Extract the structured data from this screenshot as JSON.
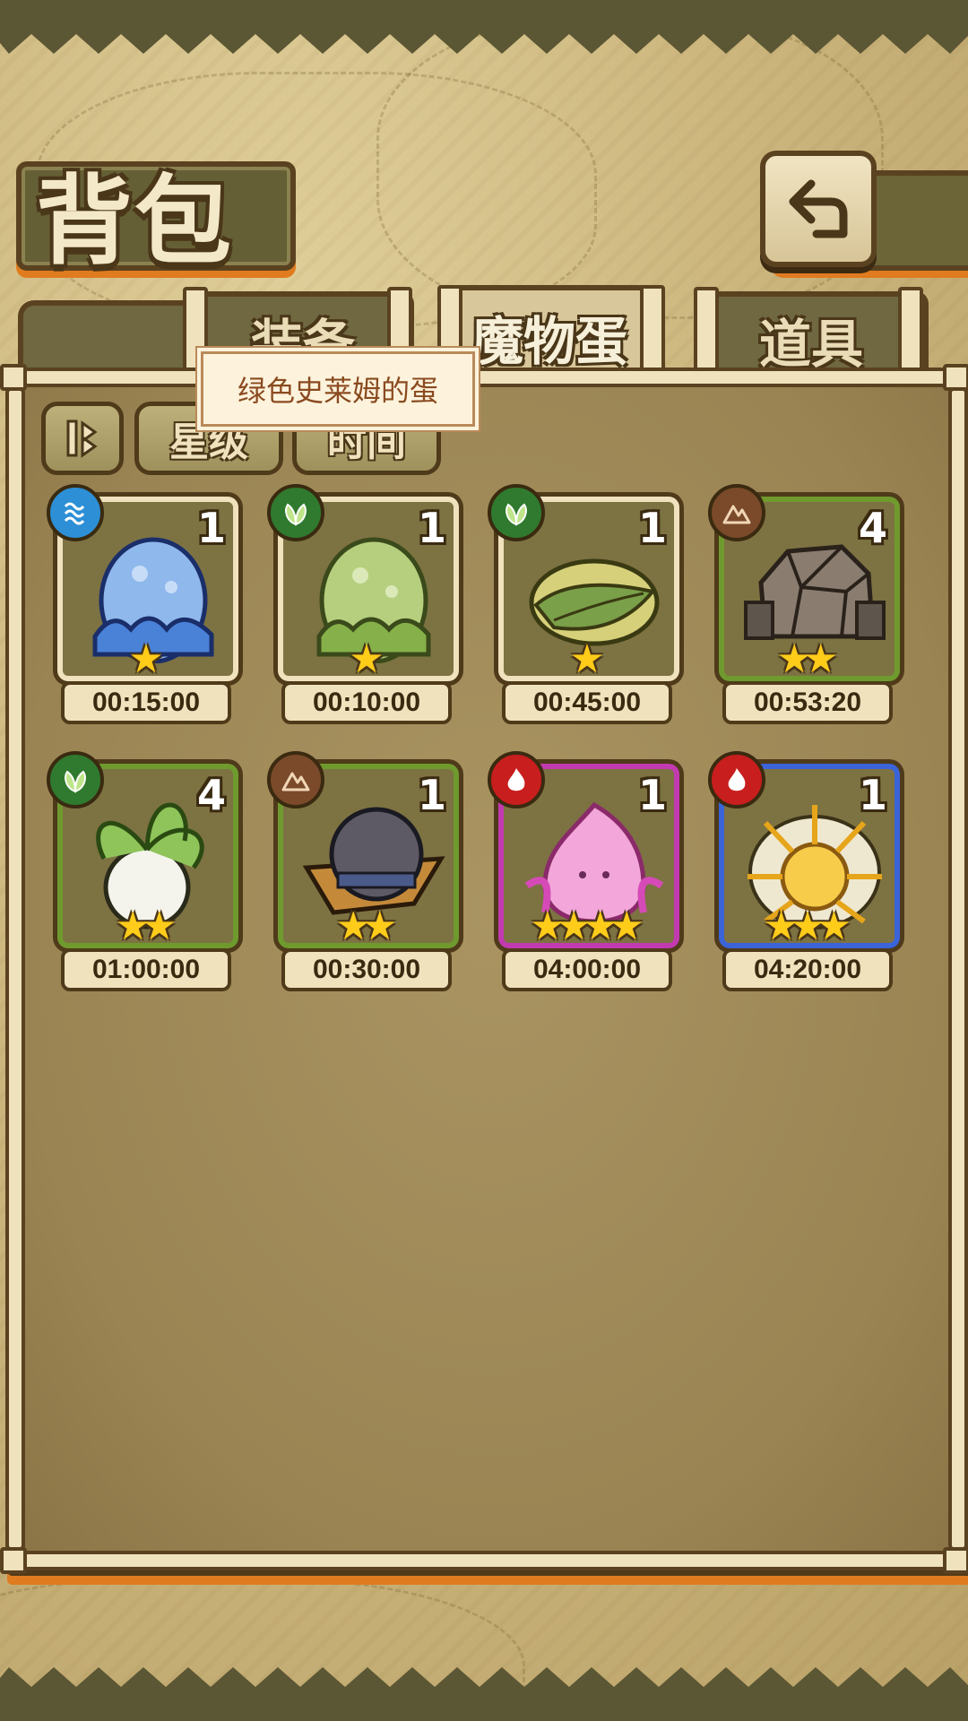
{
  "header": {
    "title": "背包"
  },
  "tabs": [
    {
      "label": "装备",
      "active": false
    },
    {
      "label": "魔物蛋",
      "active": true
    },
    {
      "label": "道具",
      "active": false
    }
  ],
  "sort": {
    "star_label": "星级",
    "time_label": "时间"
  },
  "tooltip": {
    "text": "绿色史莱姆的蛋"
  },
  "colors": {
    "accent_orange": "#e07b1f",
    "frame_dark": "#4f3a1a",
    "water": "#2d8fd6",
    "grass": "#2f7a2f",
    "earth": "#7a4a2a",
    "fire": "#c81e1e"
  },
  "eggs": [
    {
      "count": "1",
      "stars": 1,
      "element": "water-icon",
      "rarity": "normal",
      "timer": "00:15:00",
      "art": "blue-slime-egg"
    },
    {
      "count": "1",
      "stars": 1,
      "element": "grass-icon",
      "rarity": "normal",
      "timer": "00:10:00",
      "art": "green-slime-egg"
    },
    {
      "count": "1",
      "stars": 1,
      "element": "grass-icon",
      "rarity": "normal",
      "timer": "00:45:00",
      "art": "leaf-egg"
    },
    {
      "count": "4",
      "stars": 2,
      "element": "earth-icon",
      "rarity": "green",
      "timer": "00:53:20",
      "art": "rock-egg"
    },
    {
      "count": "4",
      "stars": 2,
      "element": "grass-icon",
      "rarity": "green",
      "timer": "01:00:00",
      "art": "radish-egg"
    },
    {
      "count": "1",
      "stars": 2,
      "element": "earth-icon",
      "rarity": "green",
      "timer": "00:30:00",
      "art": "hat-egg"
    },
    {
      "count": "1",
      "stars": 4,
      "element": "fire-icon",
      "rarity": "purple",
      "timer": "04:00:00",
      "art": "pink-flame-egg"
    },
    {
      "count": "1",
      "stars": 3,
      "element": "fire-icon",
      "rarity": "blue",
      "timer": "04:20:00",
      "art": "sun-egg"
    }
  ]
}
